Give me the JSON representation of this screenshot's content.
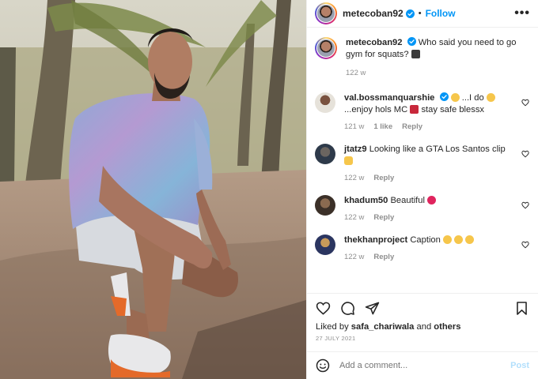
{
  "header": {
    "username": "metecoban92",
    "separator": "•",
    "follow_label": "Follow",
    "more_icon": "more-horizontal-icon"
  },
  "caption": {
    "username": "metecoban92",
    "text": "Who said you need to go gym for squats?",
    "emoji": "man-running-emoji",
    "time": "122 w"
  },
  "comments": [
    {
      "username": "val.bossmanquarshie",
      "verified": true,
      "text_a": "...I do",
      "text_b": "...enjoy hols MC",
      "text_c": "stay safe blessx",
      "time": "121 w",
      "likes": "1 like",
      "reply": "Reply"
    },
    {
      "username": "jtatz9",
      "text": "Looking like a GTA Los Santos clip",
      "time": "122 w",
      "reply": "Reply"
    },
    {
      "username": "khadum50",
      "text": "Beautiful",
      "time": "122 w",
      "reply": "Reply"
    },
    {
      "username": "thekhanproject",
      "text": "Caption",
      "time": "122 w",
      "reply": "Reply"
    }
  ],
  "liked_by": {
    "prefix": "Liked by",
    "user": "safa_chariwala",
    "and": "and",
    "others": "others"
  },
  "date": "27 JULY 2021",
  "add_comment": {
    "placeholder": "Add a comment...",
    "post_label": "Post"
  },
  "colors": {
    "link": "#0095f6",
    "muted": "#8e8e8e",
    "text": "#262626",
    "post_disabled": "#b2dffc"
  }
}
